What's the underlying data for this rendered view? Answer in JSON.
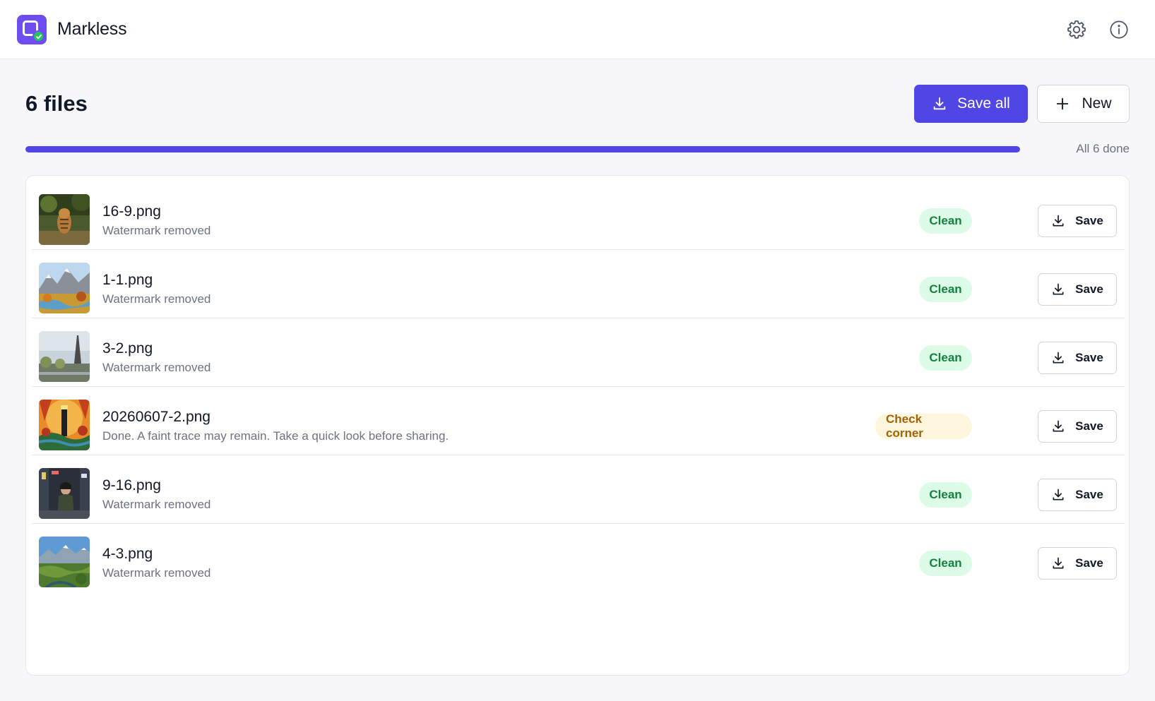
{
  "app": {
    "title": "Markless"
  },
  "header": {
    "settings_icon": "gear-icon",
    "info_icon": "info-icon"
  },
  "summary": {
    "files_label": "6 files",
    "save_all_label": "Save all",
    "new_label": "New",
    "progress_fraction": 1.0,
    "progress_text": "All 6 done"
  },
  "colors": {
    "accent": "#4f46e5",
    "clean_bg": "#dcfce7",
    "clean_text": "#15803d",
    "warn_bg": "#fef6dc",
    "warn_text": "#a16207"
  },
  "files": [
    {
      "name": "16-9.png",
      "status": "Watermark removed",
      "badge": "Clean",
      "badge_type": "clean",
      "save_label": "Save"
    },
    {
      "name": "1-1.png",
      "status": "Watermark removed",
      "badge": "Clean",
      "badge_type": "clean",
      "save_label": "Save"
    },
    {
      "name": "3-2.png",
      "status": "Watermark removed",
      "badge": "Clean",
      "badge_type": "clean",
      "save_label": "Save"
    },
    {
      "name": "20260607-2.png",
      "status": "Done. A faint trace may remain. Take a quick look before sharing.",
      "badge": "Check corner",
      "badge_type": "warn",
      "save_label": "Save"
    },
    {
      "name": "9-16.png",
      "status": "Watermark removed",
      "badge": "Clean",
      "badge_type": "clean",
      "save_label": "Save"
    },
    {
      "name": "4-3.png",
      "status": "Watermark removed",
      "badge": "Clean",
      "badge_type": "clean",
      "save_label": "Save"
    }
  ]
}
